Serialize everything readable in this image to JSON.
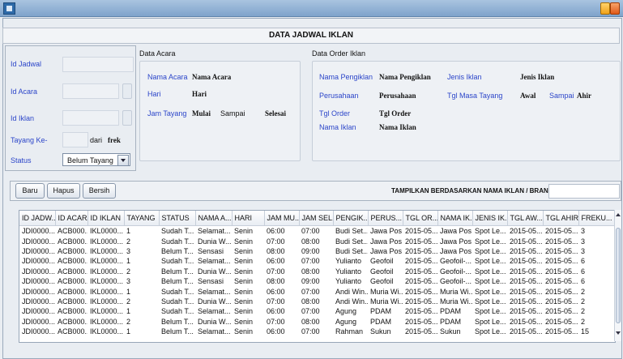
{
  "header": {
    "title": "DATA JADWAL IKLAN"
  },
  "form": {
    "id_jadwal_label": "Id Jadwal",
    "id_acara_label": "Id Acara",
    "id_iklan_label": "Id Iklan",
    "tayang_label": "Tayang Ke-",
    "dari_label": "dari",
    "frek_label": "frek",
    "status_label": "Status",
    "status_value": "Belum Tayang"
  },
  "acara": {
    "title": "Data Acara",
    "nama_acara_label": "Nama Acara",
    "nama_acara_value": "Nama Acara",
    "hari_label": "Hari",
    "hari_value": "Hari",
    "jam_tayang_label": "Jam Tayang",
    "mulai_value": "Mulai",
    "sampai_label": "Sampai",
    "selesai_value": "Selesai"
  },
  "order": {
    "title": "Data Order Iklan",
    "nama_pengiklan_label": "Nama Pengiklan",
    "nama_pengiklan_value": "Nama Pengiklan",
    "perusahaan_label": "Perusahaan",
    "perusahaan_value": "Perusahaan",
    "tgl_order_label": "Tgl Order",
    "tgl_order_value": "Tgl Order",
    "nama_iklan_label": "Nama Iklan",
    "nama_iklan_value": "Nama Iklan",
    "jenis_iklan_label": "Jenis Iklan",
    "jenis_iklan_value": "Jenis Iklan",
    "tgl_masa_label": "Tgl Masa Tayang",
    "awal_value": "Awal",
    "sampai_label": "Sampai",
    "akhir_value": "Ahir"
  },
  "toolbar": {
    "baru_label": "Baru",
    "hapus_label": "Hapus",
    "bersih_label": "Bersih",
    "search_label": "TAMPILKAN BERDASARKAN NAMA IKLAN / BRAND :"
  },
  "table": {
    "columns": [
      "ID JADW...",
      "ID ACARA",
      "ID IKLAN",
      "TAYANG",
      "STATUS",
      "NAMA A...",
      "HARI",
      "JAM MU...",
      "JAM SEL...",
      "PENGIK...",
      "PERUS...",
      "TGL OR...",
      "NAMA IK...",
      "JENIS IK...",
      "TGL AW...",
      "TGL AHIR",
      "FREKU..."
    ],
    "rows": [
      [
        "JDI0000...",
        "ACB000...",
        "IKL0000...",
        "1",
        "Sudah T...",
        "Selamat...",
        "Senin",
        "06:00",
        "07:00",
        "Budi Set...",
        "Jawa Pos",
        "2015-05...",
        "Jawa Pos",
        "Spot Le...",
        "2015-05...",
        "2015-05...",
        "3"
      ],
      [
        "JDI0000...",
        "ACB000...",
        "IKL0000...",
        "2",
        "Sudah T...",
        "Dunia W...",
        "Senin",
        "07:00",
        "08:00",
        "Budi Set...",
        "Jawa Pos",
        "2015-05...",
        "Jawa Pos",
        "Spot Le...",
        "2015-05...",
        "2015-05...",
        "3"
      ],
      [
        "JDI0000...",
        "ACB000...",
        "IKL0000...",
        "3",
        "Belum T...",
        "Sensasi",
        "Senin",
        "08:00",
        "09:00",
        "Budi Set...",
        "Jawa Pos",
        "2015-05...",
        "Jawa Pos",
        "Spot Le...",
        "2015-05...",
        "2015-05...",
        "3"
      ],
      [
        "JDI0000...",
        "ACB000...",
        "IKL0000...",
        "1",
        "Sudah T...",
        "Selamat...",
        "Senin",
        "06:00",
        "07:00",
        "Yulianto",
        "Geofoil",
        "2015-05...",
        "Geofoil-...",
        "Spot Le...",
        "2015-05...",
        "2015-05...",
        "6"
      ],
      [
        "JDI0000...",
        "ACB000...",
        "IKL0000...",
        "2",
        "Belum T...",
        "Dunia W...",
        "Senin",
        "07:00",
        "08:00",
        "Yulianto",
        "Geofoil",
        "2015-05...",
        "Geofoil-...",
        "Spot Le...",
        "2015-05...",
        "2015-05...",
        "6"
      ],
      [
        "JDI0000...",
        "ACB000...",
        "IKL0000...",
        "3",
        "Belum T...",
        "Sensasi",
        "Senin",
        "08:00",
        "09:00",
        "Yulianto",
        "Geofoil",
        "2015-05...",
        "Geofoil-...",
        "Spot Le...",
        "2015-05...",
        "2015-05...",
        "6"
      ],
      [
        "JDI0000...",
        "ACB000...",
        "IKL0000...",
        "1",
        "Sudah T...",
        "Selamat...",
        "Senin",
        "06:00",
        "07:00",
        "Andi Win...",
        "Muria Wi...",
        "2015-05...",
        "Muria Wi...",
        "Spot Le...",
        "2015-05...",
        "2015-05...",
        "2"
      ],
      [
        "JDI0000...",
        "ACB000...",
        "IKL0000...",
        "2",
        "Sudah T...",
        "Dunia W...",
        "Senin",
        "07:00",
        "08:00",
        "Andi Win...",
        "Muria Wi...",
        "2015-05...",
        "Muria Wi...",
        "Spot Le...",
        "2015-05...",
        "2015-05...",
        "2"
      ],
      [
        "JDI0000...",
        "ACB000...",
        "IKL0000...",
        "1",
        "Sudah T...",
        "Selamat...",
        "Senin",
        "06:00",
        "07:00",
        "Agung",
        "PDAM",
        "2015-05...",
        "PDAM",
        "Spot Le...",
        "2015-05...",
        "2015-05...",
        "2"
      ],
      [
        "JDI0000...",
        "ACB000...",
        "IKL0000...",
        "2",
        "Belum T...",
        "Dunia W...",
        "Senin",
        "07:00",
        "08:00",
        "Agung",
        "PDAM",
        "2015-05...",
        "PDAM",
        "Spot Le...",
        "2015-05...",
        "2015-05...",
        "2"
      ],
      [
        "JDI0000...",
        "ACB000...",
        "IKL0000...",
        "1",
        "Belum T...",
        "Selamat...",
        "Senin",
        "06:00",
        "07:00",
        "Rahman",
        "Sukun",
        "2015-05...",
        "Sukun",
        "Spot Le...",
        "2015-05...",
        "2015-05...",
        "15"
      ]
    ]
  }
}
